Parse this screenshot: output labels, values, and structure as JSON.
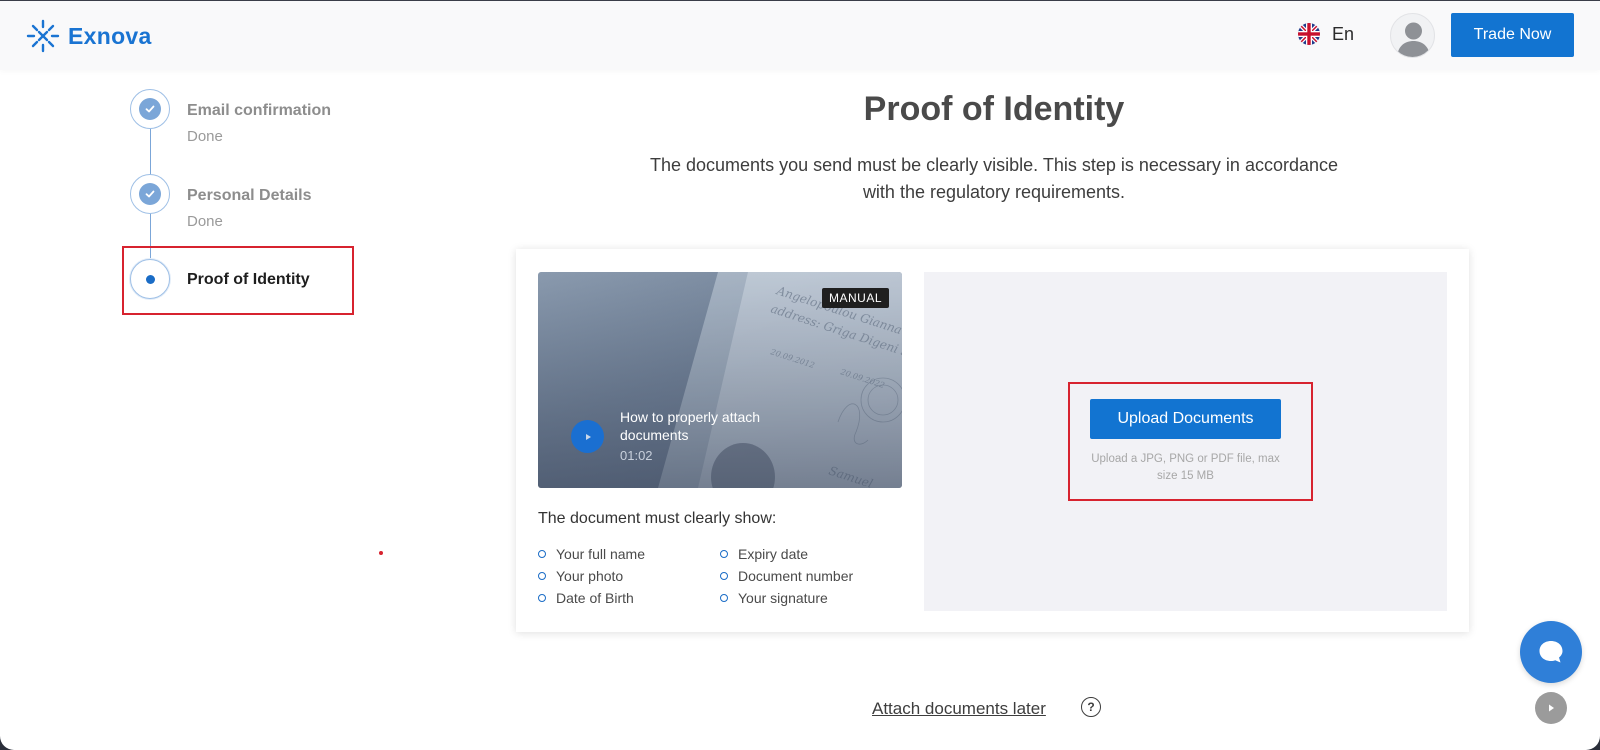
{
  "header": {
    "brand": "Exnova",
    "language": "En",
    "trade_button": "Trade Now"
  },
  "stepper": {
    "steps": [
      {
        "title": "Email confirmation",
        "status": "Done",
        "state": "done"
      },
      {
        "title": "Personal Details",
        "status": "Done",
        "state": "done"
      },
      {
        "title": "Proof of Identity",
        "status": "",
        "state": "active"
      }
    ]
  },
  "main": {
    "title": "Proof of Identity",
    "description": "The documents you send must be clearly visible. This step is necessary in accordance with the regulatory requirements.",
    "video": {
      "badge": "MANUAL",
      "title": "How to properly attach documents",
      "duration": "01:02"
    },
    "requirements": {
      "title": "The document must clearly show:",
      "items": [
        "Your full name",
        "Your photo",
        "Date of Birth",
        "Expiry date",
        "Document number",
        "Your signature"
      ]
    },
    "upload": {
      "button": "Upload Documents",
      "hint": "Upload a JPG, PNG or PDF file, max size 15 MB"
    },
    "attach_later": "Attach documents later"
  },
  "colors": {
    "accent": "#1274d1",
    "highlight": "#d7232f",
    "step_done": "#7ba6d8"
  }
}
